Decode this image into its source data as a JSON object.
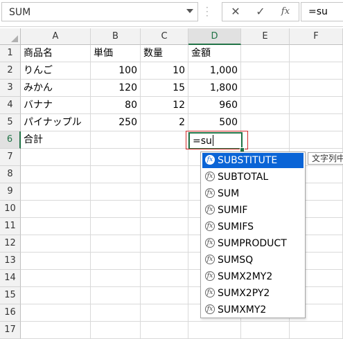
{
  "formula_bar": {
    "name_box": "SUM",
    "cancel_icon": "✕",
    "enter_icon": "✓",
    "fx_icon": "fx",
    "content": "=su"
  },
  "columns": [
    "A",
    "B",
    "C",
    "D",
    "E",
    "F"
  ],
  "rows": [
    "1",
    "2",
    "3",
    "4",
    "5",
    "6",
    "7",
    "8",
    "9",
    "10",
    "11",
    "12",
    "13",
    "14",
    "15",
    "16",
    "17"
  ],
  "cells": {
    "r1": [
      "商品名",
      "単価",
      "数量",
      "金額"
    ],
    "r2": [
      "りんご",
      "100",
      "10",
      "1,000"
    ],
    "r3": [
      "みかん",
      "120",
      "15",
      "1,800"
    ],
    "r4": [
      "バナナ",
      "80",
      "12",
      "960"
    ],
    "r5": [
      "パイナップル",
      "250",
      "2",
      "500"
    ],
    "r6": [
      "合計"
    ]
  },
  "active_cell": {
    "text": "=su",
    "selected_column": "D",
    "selected_row": "6"
  },
  "autocomplete": {
    "items": [
      "SUBSTITUTE",
      "SUBTOTAL",
      "SUM",
      "SUMIF",
      "SUMIFS",
      "SUMPRODUCT",
      "SUMSQ",
      "SUMX2MY2",
      "SUMX2PY2",
      "SUMXMY2"
    ],
    "highlighted_index": 0,
    "icon_glyph": "fx"
  },
  "tooltip": "文字列中",
  "colors": {
    "excel_green": "#217346",
    "highlight": "#0a64d6",
    "annotation_red": "#d32b2b"
  }
}
